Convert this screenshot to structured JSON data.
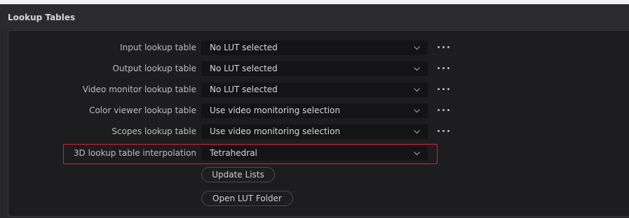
{
  "panel": {
    "title": "Lookup Tables"
  },
  "rows": [
    {
      "label": "Input lookup table",
      "value": "No LUT selected",
      "has_more": true
    },
    {
      "label": "Output lookup table",
      "value": "No LUT selected",
      "has_more": true
    },
    {
      "label": "Video monitor lookup table",
      "value": "No LUT selected",
      "has_more": true
    },
    {
      "label": "Color viewer lookup table",
      "value": "Use video monitoring selection",
      "has_more": true
    },
    {
      "label": "Scopes lookup table",
      "value": "Use video monitoring selection",
      "has_more": true
    },
    {
      "label": "3D lookup table interpolation",
      "value": "Tetrahedral",
      "has_more": false
    }
  ],
  "buttons": {
    "update_lists": "Update Lists",
    "open_lut_folder": "Open LUT Folder"
  },
  "colors": {
    "highlight": "#d9232f",
    "panel_bg": "#28282a",
    "field_bg": "#141416"
  },
  "icons": {
    "chevron": "chevron-down-icon",
    "more": "more-horizontal-icon"
  }
}
